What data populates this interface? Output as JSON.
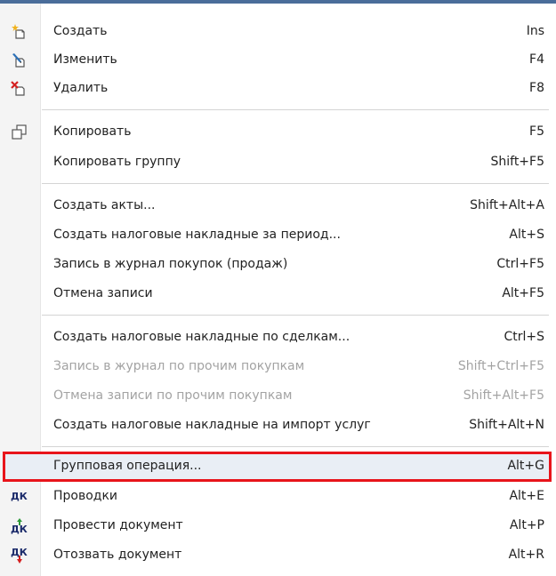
{
  "menu": {
    "items": [
      {
        "label": "Создать",
        "shortcut": "Ins",
        "icon": "create-icon",
        "enabled": true
      },
      {
        "label": "Изменить",
        "shortcut": "F4",
        "icon": "edit-icon",
        "enabled": true
      },
      {
        "label": "Удалить",
        "shortcut": "F8",
        "icon": "delete-icon",
        "enabled": true
      },
      {
        "label": "Копировать",
        "shortcut": "F5",
        "icon": "copy-icon",
        "enabled": true
      },
      {
        "label": "Копировать группу",
        "shortcut": "Shift+F5",
        "icon": "",
        "enabled": true
      },
      {
        "label": "Создать акты...",
        "shortcut": "Shift+Alt+A",
        "icon": "",
        "enabled": true
      },
      {
        "label": "Создать налоговые накладные за период...",
        "shortcut": "Alt+S",
        "icon": "",
        "enabled": true
      },
      {
        "label": "Запись в журнал покупок (продаж)",
        "shortcut": "Ctrl+F5",
        "icon": "",
        "enabled": true
      },
      {
        "label": "Отмена записи",
        "shortcut": "Alt+F5",
        "icon": "",
        "enabled": true
      },
      {
        "label": "Создать налоговые накладные по сделкам...",
        "shortcut": "Ctrl+S",
        "icon": "",
        "enabled": true
      },
      {
        "label": "Запись в журнал по прочим покупкам",
        "shortcut": "Shift+Ctrl+F5",
        "icon": "",
        "enabled": false
      },
      {
        "label": "Отмена записи по прочим покупкам",
        "shortcut": "Shift+Alt+F5",
        "icon": "",
        "enabled": false
      },
      {
        "label": "Создать налоговые накладные на импорт услуг",
        "shortcut": "Shift+Alt+N",
        "icon": "",
        "enabled": true
      },
      {
        "label": "Групповая операция...",
        "shortcut": "Alt+G",
        "icon": "",
        "enabled": true,
        "highlighted": true
      },
      {
        "label": "Проводки",
        "shortcut": "Alt+E",
        "icon": "dk-icon",
        "enabled": true
      },
      {
        "label": "Провести документ",
        "shortcut": "Alt+P",
        "icon": "dk-post-icon",
        "enabled": true
      },
      {
        "label": "Отозвать документ",
        "shortcut": "Alt+R",
        "icon": "dk-revoke-icon",
        "enabled": true
      }
    ],
    "dk_icon_text": "ДК"
  },
  "colors": {
    "highlight_border": "#e8141b",
    "disabled_text": "#a3a3a3",
    "text": "#222222",
    "accent_green": "#2e9a3a",
    "accent_red": "#d42020"
  }
}
